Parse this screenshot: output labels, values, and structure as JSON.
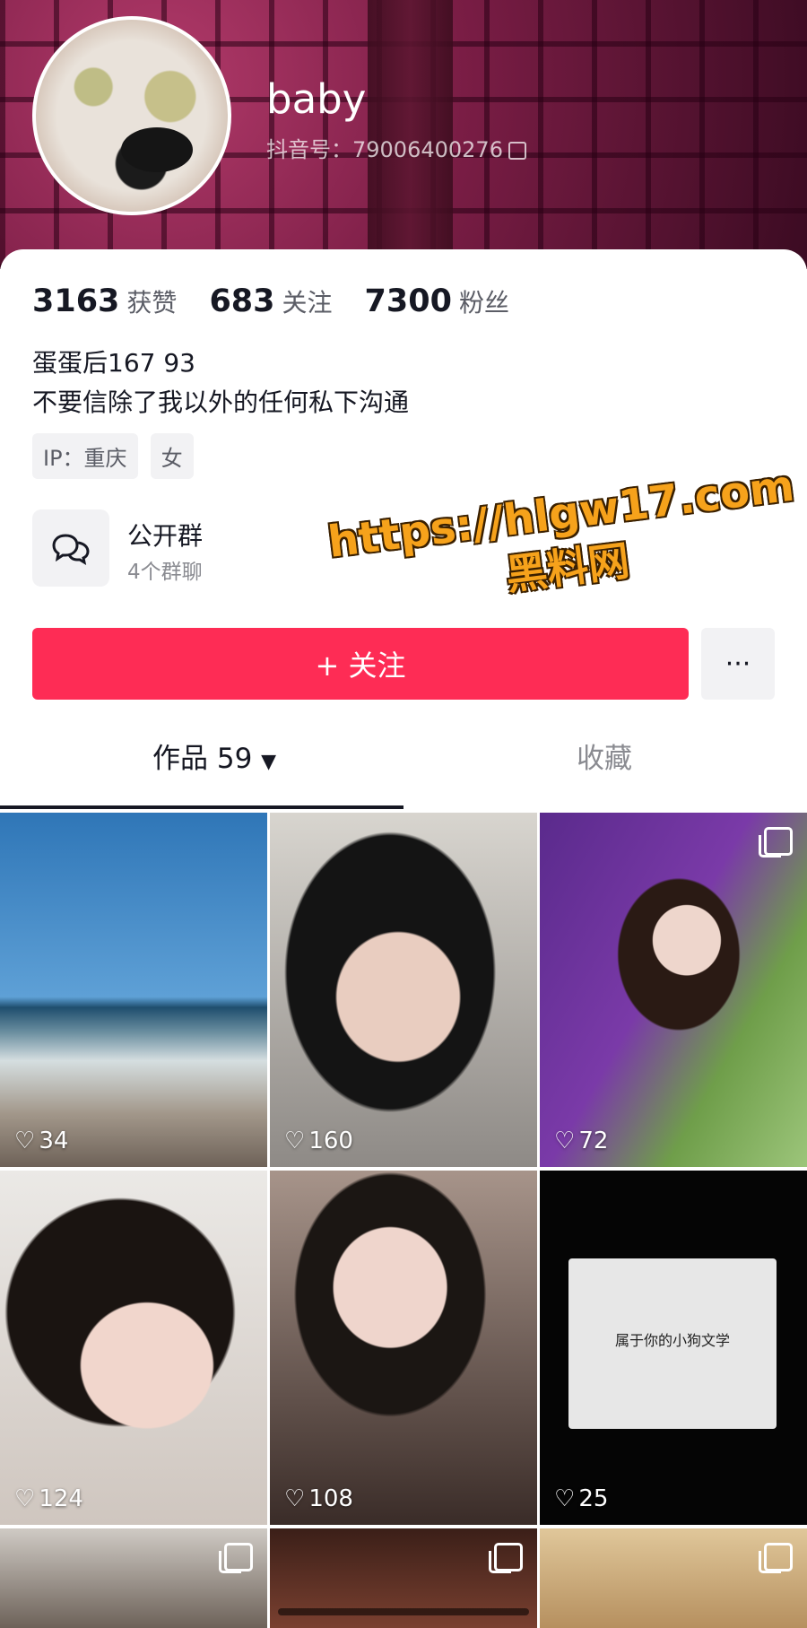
{
  "profile": {
    "username": "baby",
    "douyin_id": "抖音号：79006400276"
  },
  "stats": [
    {
      "value": "3163",
      "label": "获赞"
    },
    {
      "value": "683",
      "label": "关注"
    },
    {
      "value": "7300",
      "label": "粉丝"
    }
  ],
  "bio": {
    "line1": "蛋蛋后167 93",
    "line2": "不要信除了我以外的任何私下沟通"
  },
  "tags": [
    "IP：重庆",
    "女"
  ],
  "group": {
    "title": "公开群",
    "subtitle": "4个群聊"
  },
  "actions": {
    "follow_label": "+ 关注",
    "more_label": "···"
  },
  "tabs": {
    "works": "作品 59",
    "favorites": "收藏"
  },
  "watermark": {
    "url": "https://hlgw17.com",
    "subtitle": "黑料网"
  },
  "grid": [
    {
      "likes": "34",
      "multi": false
    },
    {
      "likes": "160",
      "multi": false
    },
    {
      "likes": "72",
      "multi": true
    },
    {
      "likes": "124",
      "multi": false
    },
    {
      "likes": "108",
      "multi": false
    },
    {
      "likes": "25",
      "multi": false
    }
  ],
  "screen_tile": {
    "caption": "属于你的小狗文学"
  },
  "colors": {
    "accent": "#fe2c55",
    "watermark": "#f6a21b"
  }
}
